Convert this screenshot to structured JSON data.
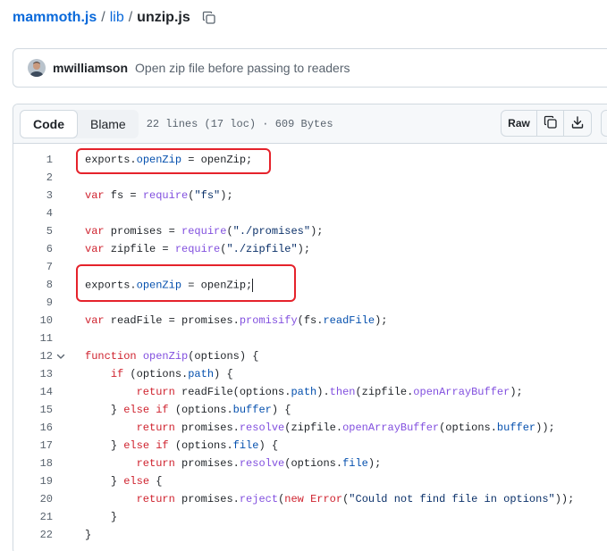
{
  "breadcrumb": {
    "repo": "mammoth.js",
    "separator": "/",
    "folder": "lib",
    "file": "unzip.js",
    "copy_icon": "copy-icon"
  },
  "commit": {
    "avatar": "avatar",
    "author": "mwilliamson",
    "message": "Open zip file before passing to readers"
  },
  "file_header": {
    "code_label": "Code",
    "blame_label": "Blame",
    "meta": "22 lines (17 loc) · 609 Bytes",
    "raw_label": "Raw",
    "copy_icon": "copy-icon",
    "download_icon": "download-icon",
    "edit_icon": "pencil-icon"
  },
  "code": {
    "line_numbers": [
      "1",
      "2",
      "3",
      "4",
      "5",
      "6",
      "7",
      "8",
      "9",
      "10",
      "11",
      "12",
      "13",
      "14",
      "15",
      "16",
      "17",
      "18",
      "19",
      "20",
      "21",
      "22"
    ],
    "fold_icon": "chevron-down-icon",
    "tokens": {
      "exports": "exports",
      "dot": ".",
      "openZip": "openZip",
      "assign_openZip_semi": " = openZip;",
      "var": "var",
      "fs_assign": " fs = ",
      "require": "require",
      "paren_open": "(",
      "fs_str": "\"fs\"",
      "close_semi": ");",
      "promises_assign": " promises = ",
      "promises_str": "\"./promises\"",
      "zipfile_assign": " zipfile = ",
      "zipfile_str": "\"./zipfile\"",
      "readFile_assign": " readFile = promises.",
      "promisify": "promisify",
      "fs_dot": "(fs.",
      "readFile": "readFile",
      "function": "function",
      "space": " ",
      "options_sig": "(options) {",
      "indent4": "    ",
      "indent8": "        ",
      "if": "if",
      "options_paren": " (options.",
      "path": "path",
      "paren_brace": ") {",
      "return": "return",
      "readFile_call": " readFile(options.",
      "path_then_mid": ").",
      "then": "then",
      "zipfile_dot": "(zipfile.",
      "openArrayBuffer": "openArrayBuffer",
      "brace_else": "} ",
      "else": "else",
      "buffer": "buffer",
      "promises_dot": " promises.",
      "resolve": "resolve",
      "options_close": "(options.",
      "paren_paren_semi": "));",
      "file": "file",
      "brace_open": " {",
      "reject": "reject",
      "new": "new",
      "Error": "Error",
      "err_str": "\"Could not find file in options\"",
      "close_brace": "}"
    }
  },
  "annotations": {
    "color": "#e5222b"
  }
}
